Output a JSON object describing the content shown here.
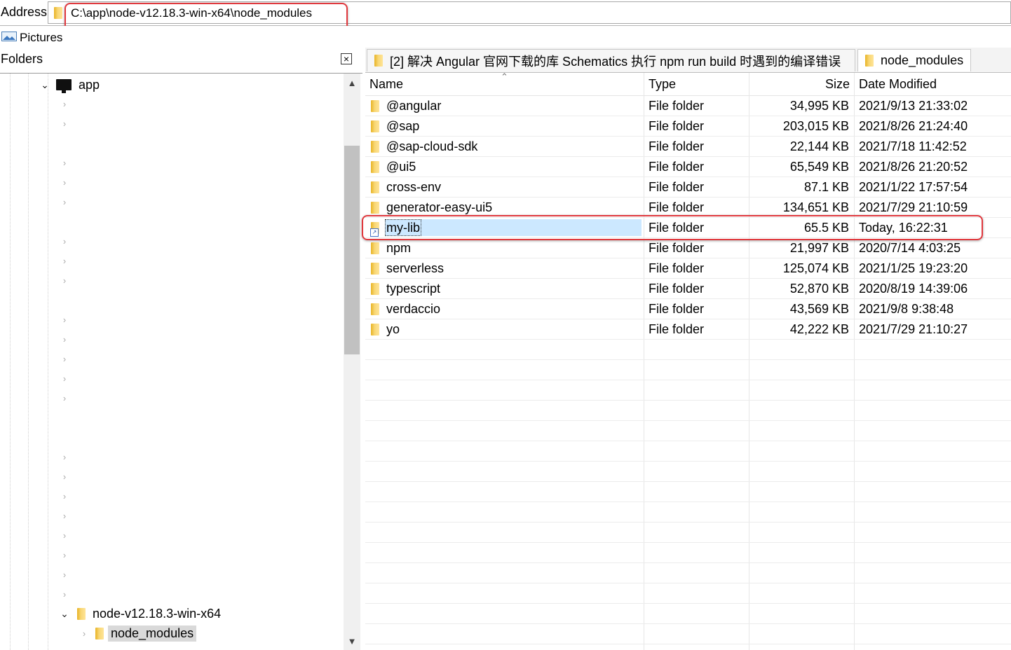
{
  "address": {
    "label": "Address",
    "path": "C:\\app\\node-v12.18.3-win-x64\\node_modules"
  },
  "quick_access": {
    "pictures_label": "Pictures"
  },
  "folders_pane": {
    "title": "Folders",
    "close_glyph": "×",
    "tree": {
      "app_label": "app",
      "node_folder_label": "node-v12.18.3-win-x64",
      "node_modules_label": "node_modules"
    }
  },
  "tabs": [
    {
      "label": "[2] 解决 Angular 官网下载的库 Schematics 执行 npm run build 时遇到的编译错误"
    },
    {
      "label": "node_modules"
    }
  ],
  "list": {
    "columns": {
      "name": "Name",
      "type": "Type",
      "size": "Size",
      "date": "Date Modified"
    },
    "rows": [
      {
        "name": "@angular",
        "type": "File folder",
        "size": "34,995 KB",
        "date": "2021/9/13 21:33:02"
      },
      {
        "name": "@sap",
        "type": "File folder",
        "size": "203,015 KB",
        "date": "2021/8/26 21:24:40"
      },
      {
        "name": "@sap-cloud-sdk",
        "type": "File folder",
        "size": "22,144 KB",
        "date": "2021/7/18 11:42:52"
      },
      {
        "name": "@ui5",
        "type": "File folder",
        "size": "65,549 KB",
        "date": "2021/8/26 21:20:52"
      },
      {
        "name": "cross-env",
        "type": "File folder",
        "size": "87.1 KB",
        "date": "2021/1/22 17:57:54"
      },
      {
        "name": "generator-easy-ui5",
        "type": "File folder",
        "size": "134,651 KB",
        "date": "2021/7/29 21:10:59"
      },
      {
        "name": "my-lib",
        "type": "File folder",
        "size": "65.5 KB",
        "date": "Today, 16:22:31"
      },
      {
        "name": "npm",
        "type": "File folder",
        "size": "21,997 KB",
        "date": "2020/7/14 4:03:25"
      },
      {
        "name": "serverless",
        "type": "File folder",
        "size": "125,074 KB",
        "date": "2021/1/25 19:23:20"
      },
      {
        "name": "typescript",
        "type": "File folder",
        "size": "52,870 KB",
        "date": "2020/8/19 14:39:06"
      },
      {
        "name": "verdaccio",
        "type": "File folder",
        "size": "43,569 KB",
        "date": "2021/9/8 9:38:48"
      },
      {
        "name": "yo",
        "type": "File folder",
        "size": "42,222 KB",
        "date": "2021/7/29 21:10:27"
      }
    ]
  },
  "colors": {
    "highlight_ring": "#e0393e",
    "selection": "#cce8ff",
    "folder": "#f8d775"
  }
}
